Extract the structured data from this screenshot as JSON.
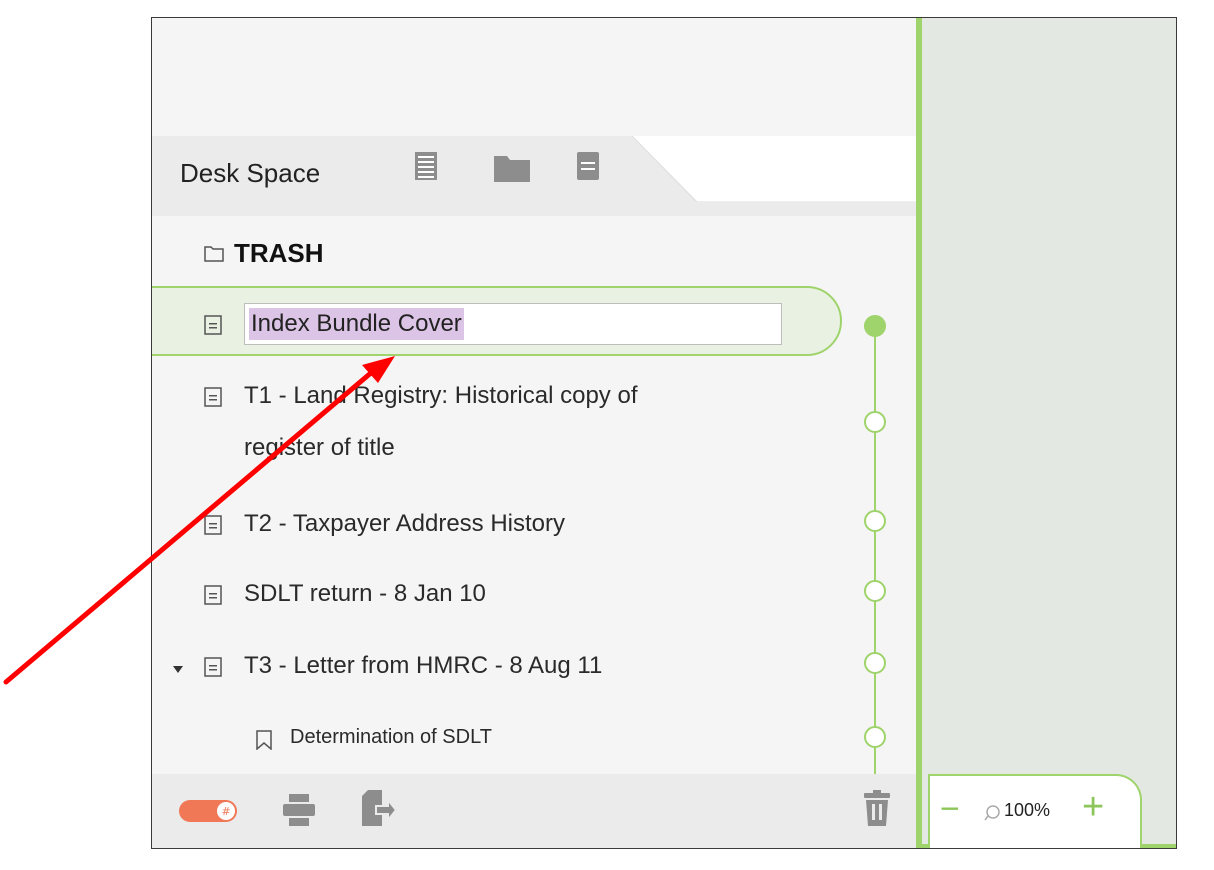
{
  "tab": {
    "title": "Desk Space"
  },
  "tab_icons": [
    "list-view-icon",
    "folder-icon",
    "document-icon"
  ],
  "list": {
    "trash_label": "TRASH",
    "selected_item": "Index Bundle Cover",
    "items": [
      {
        "line1": "T1 - Land Registry: Historical copy of",
        "line2": "register of title"
      },
      {
        "line1": "T2 - Taxpayer Address History"
      },
      {
        "line1": "SDLT return - 8 Jan 10"
      },
      {
        "line1": "T3 - Letter from HMRC - 8 Aug 11"
      }
    ],
    "bookmark_item": "Determination of SDLT"
  },
  "zoom": {
    "minus": "−",
    "value": "100%",
    "plus": "+"
  },
  "colors": {
    "accent": "#9fd36b",
    "toggle": "#f07857",
    "selection": "#dcc4e6",
    "annotation_arrow": "#ff0000"
  }
}
